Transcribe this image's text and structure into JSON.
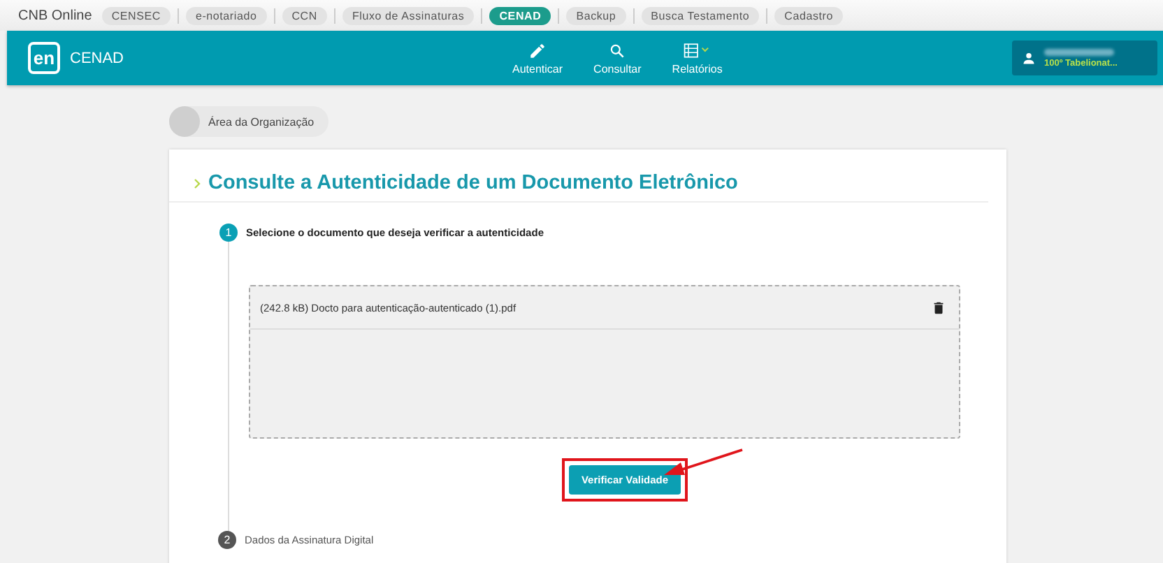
{
  "top_bar": {
    "brand": "CNB Online",
    "tabs": [
      {
        "label": "CENSEC",
        "selected": false
      },
      {
        "label": "e-notariado",
        "selected": false
      },
      {
        "label": "CCN",
        "selected": false
      },
      {
        "label": "Fluxo de Assinaturas",
        "selected": false
      },
      {
        "label": "CENAD",
        "selected": true
      },
      {
        "label": "Backup",
        "selected": false
      },
      {
        "label": "Busca Testamento",
        "selected": false
      },
      {
        "label": "Cadastro",
        "selected": false
      }
    ]
  },
  "header": {
    "logo": "en",
    "title": "CENAD",
    "nav": [
      {
        "label": "Autenticar",
        "kind": "edit"
      },
      {
        "label": "Consultar",
        "kind": "query"
      },
      {
        "label": "Relatórios",
        "kind": "reports"
      }
    ],
    "user": {
      "role": "100º Tabelionat..."
    }
  },
  "breadcrumb": "Área da Organização",
  "card": {
    "title": "Consulte a Autenticidade de um Documento Eletrônico",
    "steps": [
      {
        "number": "1",
        "label": "Selecione o documento que deseja verificar a autenticidade",
        "active": true
      },
      {
        "number": "2",
        "label": "Dados da Assinatura Digital",
        "active": false
      }
    ],
    "file": "(242.8 kB) Docto para autenticação-autenticado (1).pdf",
    "button": "Verificar Validade"
  }
}
